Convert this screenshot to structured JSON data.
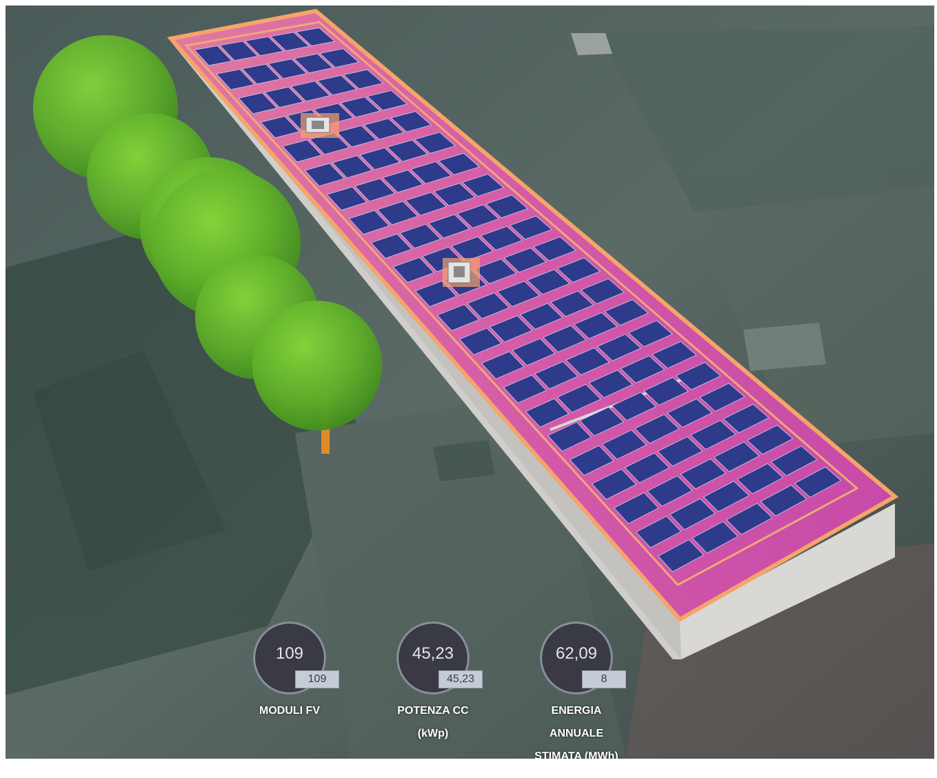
{
  "stats": [
    {
      "value": "109",
      "sub": "109",
      "label": "MODULI FV"
    },
    {
      "value": "45,23",
      "sub": "45,23",
      "label_lines": [
        "POTENZA CC",
        "(kWp)"
      ]
    },
    {
      "value": "62,09",
      "sub": "8",
      "label_lines": [
        "ENERGIA",
        "ANNUALE",
        "STIMATA (MWh)"
      ]
    }
  ],
  "colors": {
    "panel": "#2e3a8a",
    "roof_edge": "#f5a46a",
    "wall": "#c8c6c3",
    "tree": "#6cbf2e",
    "gauge_bg": "#3a3a44",
    "gauge_ring": "#7f8794"
  }
}
